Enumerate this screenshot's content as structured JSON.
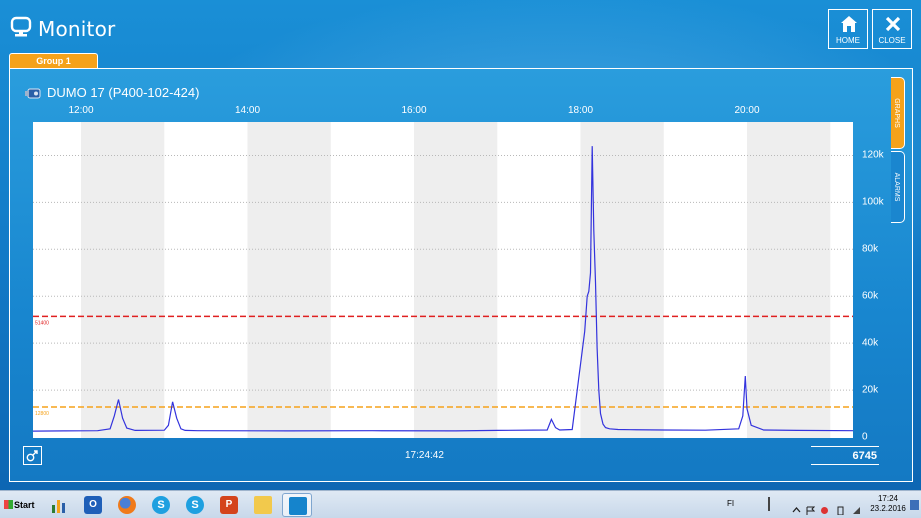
{
  "app": {
    "title": "Monitor",
    "home_label": "HOME",
    "close_label": "CLOSE",
    "group_tab": "Group 1"
  },
  "device": {
    "title": "DUMO 17 (P400-102-424)"
  },
  "side_tabs": {
    "graphs": "GRAPHS",
    "alarms": "ALARMS"
  },
  "footer": {
    "current_time": "17:24:42",
    "current_value": "6745"
  },
  "colors": {
    "accent": "#f5a21a",
    "background": "#1584cc",
    "series": "#3333dd",
    "alarm_high": "#e02020",
    "alarm_low": "#f5a21a"
  },
  "chart_data": {
    "type": "line",
    "x_ticks": [
      "12:00",
      "14:00",
      "16:00",
      "18:00",
      "20:00"
    ],
    "x_range_hours": [
      11.4,
      21.3
    ],
    "y_ticks": [
      "0",
      "20k",
      "40k",
      "60k",
      "80k",
      "100k",
      "120k"
    ],
    "ylim": [
      0,
      130000
    ],
    "grid": true,
    "shaded_bands": true,
    "thresholds": [
      {
        "label": "51400",
        "value": 51400,
        "color": "#e02020"
      },
      {
        "label": "12800",
        "value": 12800,
        "color": "#f5a21a"
      }
    ],
    "series": [
      {
        "x": [
          11.4,
          11.8,
          12.2,
          12.35,
          12.4,
          12.45,
          12.5,
          12.55,
          12.65,
          13.0,
          13.05,
          13.1,
          13.15,
          13.2,
          13.25,
          13.4,
          14.5,
          15.5,
          16.5,
          17.0,
          17.6,
          17.65,
          17.7,
          17.75,
          17.9,
          18.05,
          18.08,
          18.1,
          18.12,
          18.14,
          18.16,
          18.18,
          18.2,
          18.22,
          18.24,
          18.27,
          18.3,
          18.35,
          18.45,
          18.6,
          19.0,
          19.5,
          19.9,
          19.95,
          19.98,
          20.0,
          20.05,
          20.2,
          20.6,
          21.3
        ],
        "y": [
          2500,
          2600,
          2700,
          3500,
          9000,
          16000,
          8000,
          3800,
          2800,
          2900,
          5000,
          15000,
          8000,
          3500,
          2800,
          2700,
          2600,
          2700,
          2600,
          2800,
          3000,
          7500,
          4000,
          3000,
          3200,
          45000,
          60000,
          62000,
          70000,
          124000,
          88000,
          66000,
          38000,
          20000,
          10000,
          5500,
          4000,
          3500,
          3200,
          3100,
          3000,
          2900,
          3500,
          9000,
          26000,
          12000,
          5000,
          3000,
          2800,
          2700
        ]
      }
    ]
  }
}
